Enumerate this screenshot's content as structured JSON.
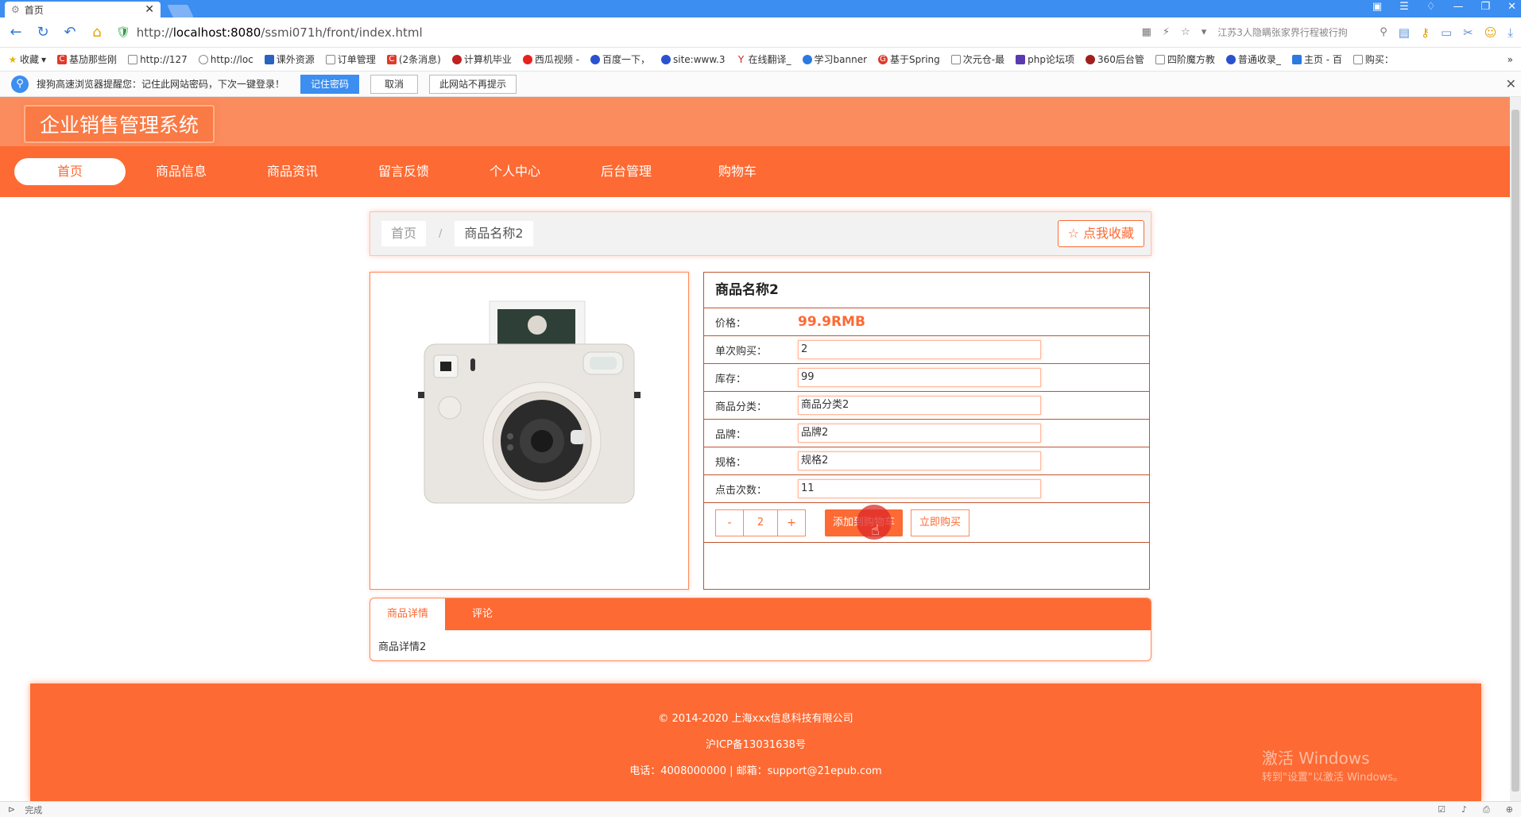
{
  "browser": {
    "tab_title": "首页",
    "url_prefix": "http://",
    "url_host": "localhost:8080",
    "url_path": "/ssmi071h/front/index.html",
    "search_text": "江苏3人隐瞒张家界行程被行拘"
  },
  "bookmarks": [
    "收藏",
    "基劢那些刚",
    "http://127",
    "http://loc",
    "课外资源",
    "订单管理",
    "(2条消息)",
    "计算机毕业",
    "西瓜视频 -",
    "百度一下，",
    "site:www.3",
    "在线翻译_",
    "学习banner",
    "基于Spring",
    "次元仓-最",
    "php论坛项",
    "360后台管",
    "四阶魔方教",
    "普通收录_",
    "主页 - 百",
    "购买："
  ],
  "password_bar": {
    "message": "搜狗高速浏览器提醒您：记住此网站密码，下次一键登录！",
    "remember": "记住密码",
    "cancel": "取消",
    "never": "此网站不再提示"
  },
  "site": {
    "logo": "企业销售管理系统",
    "nav": [
      "首页",
      "商品信息",
      "商品资讯",
      "留言反馈",
      "个人中心",
      "后台管理",
      "购物车"
    ]
  },
  "breadcrumb": {
    "home": "首页",
    "sep": "/",
    "current": "商品名称2",
    "favorite": "☆ 点我收藏"
  },
  "product": {
    "name": "商品名称2",
    "price_label": "价格：",
    "price": "99.9RMB",
    "fields": [
      {
        "label": "单次购买：",
        "value": "2"
      },
      {
        "label": "库存：",
        "value": "99"
      },
      {
        "label": "商品分类：",
        "value": "商品分类2"
      },
      {
        "label": "品牌：",
        "value": "品牌2"
      },
      {
        "label": "规格：",
        "value": "规格2"
      },
      {
        "label": "点击次数：",
        "value": "11"
      }
    ],
    "qty": "2",
    "minus": "-",
    "plus": "+",
    "add_cart": "添加到购物车",
    "buy_now": "立即购买"
  },
  "tabs": {
    "detail": "商品详情",
    "comment": "评论",
    "content": "商品详情2"
  },
  "footer": {
    "line1": "© 2014-2020 上海xxx信息科技有限公司",
    "line2": "沪ICP备13031638号",
    "line3": "电话：4008000000 | 邮箱：support@21epub.com",
    "watermark1": "激活 Windows",
    "watermark2": "转到\"设置\"以激活 Windows。"
  },
  "status": {
    "left": "完成"
  }
}
